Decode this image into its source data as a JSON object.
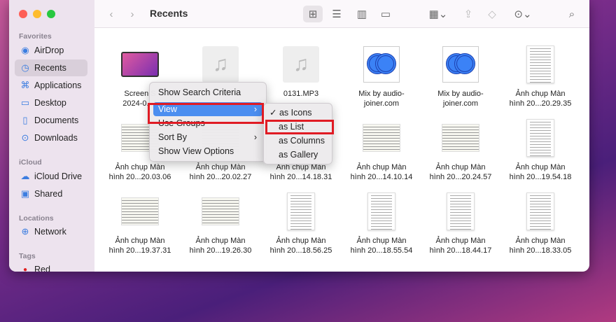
{
  "window": {
    "title": "Recents"
  },
  "sidebar": {
    "favorites": "Favorites",
    "icloud": "iCloud",
    "locations": "Locations",
    "tags": "Tags",
    "items": [
      {
        "label": "AirDrop",
        "icon": "airdrop-icon"
      },
      {
        "label": "Recents",
        "icon": "clock-icon"
      },
      {
        "label": "Applications",
        "icon": "applications-icon"
      },
      {
        "label": "Desktop",
        "icon": "desktop-icon"
      },
      {
        "label": "Documents",
        "icon": "document-icon"
      },
      {
        "label": "Downloads",
        "icon": "download-icon"
      },
      {
        "label": "iCloud Drive",
        "icon": "cloud-icon"
      },
      {
        "label": "Shared",
        "icon": "shared-folder-icon"
      },
      {
        "label": "Network",
        "icon": "globe-icon"
      },
      {
        "label": "Red",
        "icon": "red-tag-icon"
      }
    ]
  },
  "files": [
    {
      "l1": "Screen S",
      "l2": "2024-0...1",
      "t": "mac"
    },
    {
      "l1": "",
      "l2": "",
      "t": "mus"
    },
    {
      "l1": "0131.MP3",
      "l2": "",
      "t": "mus"
    },
    {
      "l1": "Mix by audio-",
      "l2": "joiner.com",
      "t": "mix"
    },
    {
      "l1": "Mix by audio-",
      "l2": "joiner.com",
      "t": "mix"
    },
    {
      "l1": "Ảnh chụp Màn",
      "l2": "hình 20...20.29.35",
      "t": "doc"
    },
    {
      "l1": "Ảnh chụp Màn",
      "l2": "hình 20...20.03.06",
      "t": "docw"
    },
    {
      "l1": "Ảnh chụp Màn",
      "l2": "hình 20...20.02.27",
      "t": "docw"
    },
    {
      "l1": "Ảnh chụp Màn",
      "l2": "hình 20...14.18.31",
      "t": "docw"
    },
    {
      "l1": "Ảnh chụp Màn",
      "l2": "hình 20...14.10.14",
      "t": "docw"
    },
    {
      "l1": "Ảnh chụp Màn",
      "l2": "hình 20...20.24.57",
      "t": "docw"
    },
    {
      "l1": "Ảnh chụp Màn",
      "l2": "hình 20...19.54.18",
      "t": "doc"
    },
    {
      "l1": "Ảnh chụp Màn",
      "l2": "hình 20...19.37.31",
      "t": "docw"
    },
    {
      "l1": "Ảnh chụp Màn",
      "l2": "hình 20...19.26.30",
      "t": "docw"
    },
    {
      "l1": "Ảnh chụp Màn",
      "l2": "hình 20...18.56.25",
      "t": "doc"
    },
    {
      "l1": "Ảnh chụp Màn",
      "l2": "hình 20...18.55.54",
      "t": "doc"
    },
    {
      "l1": "Ảnh chụp Màn",
      "l2": "hình 20...18.44.17",
      "t": "doc"
    },
    {
      "l1": "Ảnh chụp Màn",
      "l2": "hình 20...18.33.05",
      "t": "doc"
    }
  ],
  "context_menu": {
    "items": [
      "Show Search Criteria",
      "View",
      "Use Groups",
      "Sort By",
      "Show View Options"
    ]
  },
  "view_submenu": {
    "items": [
      "as Icons",
      "as List",
      "as Columns",
      "as Gallery"
    ],
    "checked": "as Icons",
    "check": "✓"
  },
  "colors": {
    "highlight": "#4b8ef0",
    "annotation": "#e01b24"
  }
}
